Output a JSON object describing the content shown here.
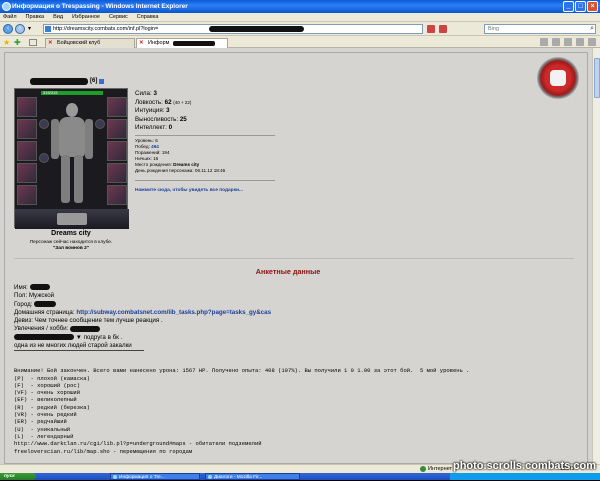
{
  "window": {
    "title": "Информация о Trespassing - Windows Internet Explorer"
  },
  "menu": [
    "Файл",
    "Правка",
    "Вид",
    "Избранное",
    "Сервис",
    "Справка"
  ],
  "address": {
    "url": "http://dreamscity.combats.com/inf.pl?login=",
    "search_placeholder": "Bing"
  },
  "tabs": [
    {
      "label": "Бойцовский клуб"
    },
    {
      "label": "Информ"
    }
  ],
  "character": {
    "level_badge": "[6]",
    "hp": "315/315",
    "stats": [
      {
        "label": "Сила:",
        "value": "3",
        "extra": ""
      },
      {
        "label": "Ловкость:",
        "value": "62",
        "extra": "(40 + 22)"
      },
      {
        "label": "Интуиция:",
        "value": "3",
        "extra": ""
      },
      {
        "label": "Выносливость:",
        "value": "25",
        "extra": ""
      },
      {
        "label": "Интеллект:",
        "value": "0",
        "extra": ""
      }
    ],
    "details": [
      {
        "label": "Уровень:",
        "value": "6"
      },
      {
        "label": "Побед:",
        "value": "494"
      },
      {
        "label": "Поражений:",
        "value": "194"
      },
      {
        "label": "Ничьих:",
        "value": "16"
      },
      {
        "label": "Место рождения:",
        "value": "Dreams city"
      },
      {
        "label": "День рождения персонажа:",
        "value": "06.11.12 18:46"
      }
    ],
    "gift_link": "Нажмите сюда, чтобы увидеть все подарки...",
    "city": "Dreams city",
    "location_line1": "Персонаж сейчас находится в клубе.",
    "location_line2": "\"Зал воинов 2\""
  },
  "profile": {
    "title": "Анкетные данные",
    "name_label": "Имя:",
    "gender_label": "Пол:",
    "gender_value": "Мужской",
    "city_label": "Город:",
    "homepage_label": "Домашняя страница:",
    "homepage_url": "http://subway.combatsnet.com/lib_tasks.php?page=tasks_gy&cas",
    "motto_label": "Девиз:",
    "motto_value": "Чем точнее сообщение тем лучше реакция .",
    "hobby_label": "Увлечения / хобби:",
    "hobby_line1": "подруга в бк  .",
    "hobby_line2": "одна из не многих людей старой закалки"
  },
  "log_lines": [
    "Внимание! Бой закончен. Всего вами нанесено урона: 1567 HP. Получено опыта: 408 (107%). Вы получили 1 0 1.00 за этот бой.  5 мой уровень .",
    "(P)  - плохой (камаска)",
    "(F)  - хороший (рос)",
    "(VF) - очень хороший",
    "(EF) - великолепный",
    "(R)  - редкий (березка)",
    "(VR) - очень редкий",
    "(ER) - редчайший",
    "(U)  - уникальный",
    "(L)  - легендарный",
    "",
    "http://www.darkclan.ru/cgi/lib.pl?p=underground#maps - обитатели подземелий",
    "freeloverscian.ru/lib/map.sho - перемещения по городам"
  ],
  "status": {
    "zone": "Интернет",
    "zoom": "100%"
  },
  "taskbar": {
    "start": "пуск",
    "tasks": [
      "Информация о Tre...",
      "Диалоги - Mozilla Fir..."
    ]
  },
  "watermark": "photo.scrolls.combats.com"
}
